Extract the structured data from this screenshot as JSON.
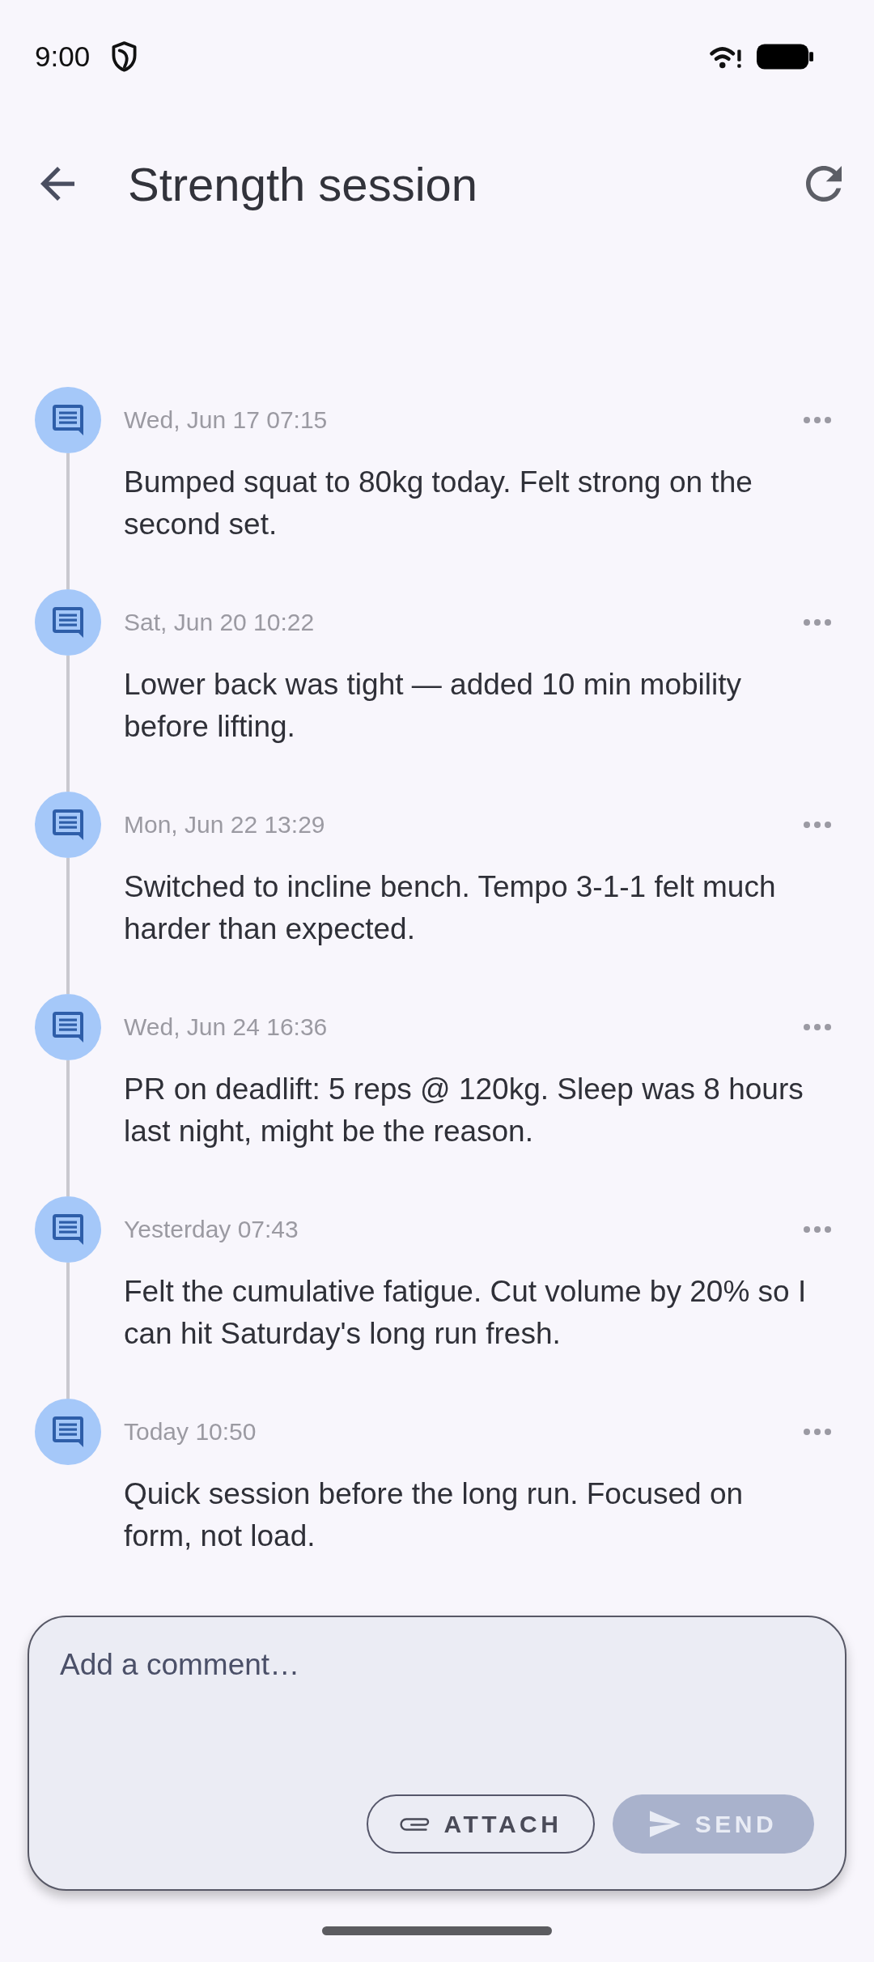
{
  "status_bar": {
    "time": "9:00"
  },
  "header": {
    "title": "Strength session"
  },
  "entries": [
    {
      "timestamp": "Wed, Jun 17 07:15",
      "text": "Bumped squat to 80kg today. Felt strong on the second set."
    },
    {
      "timestamp": "Sat, Jun 20 10:22",
      "text": "Lower back was tight — added 10 min mobility before lifting."
    },
    {
      "timestamp": "Mon, Jun 22 13:29",
      "text": "Switched to incline bench. Tempo 3-1-1 felt much harder than expected."
    },
    {
      "timestamp": "Wed, Jun 24 16:36",
      "text": "PR on deadlift: 5 reps @ 120kg. Sleep was 8 hours last night, might be the reason."
    },
    {
      "timestamp": "Yesterday 07:43",
      "text": "Felt the cumulative fatigue. Cut volume by 20% so I can hit Saturday's long run fresh."
    },
    {
      "timestamp": "Today 10:50",
      "text": "Quick session before the long run. Focused on form, not load."
    }
  ],
  "composer": {
    "placeholder": "Add a comment…",
    "buttons": [
      {
        "label": "ATTACH",
        "kind": "attach",
        "disabled": false
      },
      {
        "label": "SEND",
        "kind": "send",
        "disabled": true
      }
    ]
  }
}
